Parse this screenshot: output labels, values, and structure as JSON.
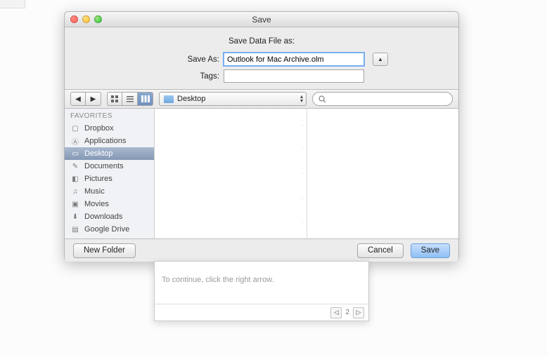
{
  "window": {
    "title": "Save"
  },
  "header": {
    "subtitle": "Save Data File as:",
    "saveas_label": "Save As:",
    "saveas_value": "Outlook for Mac Archive.olm",
    "tags_label": "Tags:",
    "tags_value": ""
  },
  "toolbar": {
    "path_label": "Desktop",
    "search_value": ""
  },
  "sidebar": {
    "header": "FAVORITES",
    "items": [
      {
        "label": "Dropbox",
        "icon": "box-icon"
      },
      {
        "label": "Applications",
        "icon": "apps-icon"
      },
      {
        "label": "Desktop",
        "icon": "desktop-icon",
        "selected": true
      },
      {
        "label": "Documents",
        "icon": "documents-icon"
      },
      {
        "label": "Pictures",
        "icon": "pictures-icon"
      },
      {
        "label": "Music",
        "icon": "music-icon"
      },
      {
        "label": "Movies",
        "icon": "movies-icon"
      },
      {
        "label": "Downloads",
        "icon": "downloads-icon"
      },
      {
        "label": "Google Drive",
        "icon": "gdrive-icon"
      }
    ]
  },
  "footer": {
    "new_folder": "New Folder",
    "cancel": "Cancel",
    "save": "Save"
  },
  "wizard": {
    "hint": "To continue, click the right arrow.",
    "page": "2"
  }
}
